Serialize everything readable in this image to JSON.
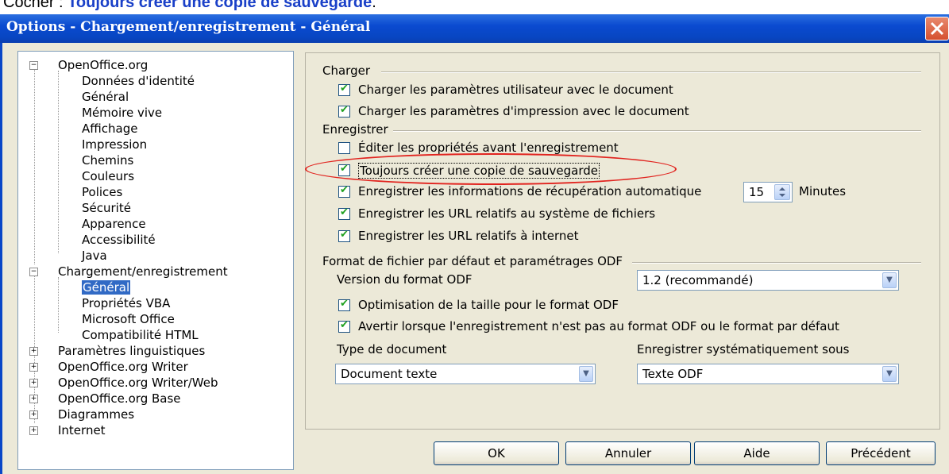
{
  "caption": {
    "prefix": "Cocher : ",
    "bold": "Toujours créer une copie de sauvegarde",
    "suffix": "."
  },
  "window": {
    "title": "Options - Chargement/enregistrement - Général"
  },
  "tree": {
    "openoffice": "OpenOffice.org",
    "oo_children": [
      "Données d'identité",
      "Général",
      "Mémoire vive",
      "Affichage",
      "Impression",
      "Chemins",
      "Couleurs",
      "Polices",
      "Sécurité",
      "Apparence",
      "Accessibilité",
      "Java"
    ],
    "load_save": "Chargement/enregistrement",
    "ls_children": [
      "Général",
      "Propriétés VBA",
      "Microsoft Office",
      "Compatibilité HTML"
    ],
    "collapsed": [
      "Paramètres linguistiques",
      "OpenOffice.org Writer",
      "OpenOffice.org Writer/Web",
      "OpenOffice.org Base",
      "Diagrammes",
      "Internet"
    ]
  },
  "load": {
    "heading": "Charger",
    "items": [
      {
        "label": "Charger les paramètres utilisateur avec le document",
        "checked": true
      },
      {
        "label": "Charger les paramètres d'impression avec le document",
        "checked": true
      }
    ]
  },
  "save": {
    "heading": "Enregistrer",
    "items": [
      {
        "label": "Éditer les propriétés avant l'enregistrement",
        "checked": false
      },
      {
        "label": "Toujours créer une copie de sauvegarde",
        "checked": true
      },
      {
        "label": "Enregistrer les informations de récupération automatique",
        "checked": true
      },
      {
        "label": "Enregistrer les URL relatifs au système de fichiers",
        "checked": true
      },
      {
        "label": "Enregistrer les URL relatifs à internet",
        "checked": true
      }
    ],
    "autosave_minutes": "15",
    "minutes_label": "Minutes"
  },
  "format": {
    "heading": "Format de fichier par défaut et paramétrages ODF",
    "version_label": "Version du format ODF",
    "version_value": "1.2 (recommandé)",
    "items": [
      {
        "label": "Optimisation de la taille pour le format ODF",
        "checked": true
      },
      {
        "label": "Avertir lorsque l'enregistrement n'est pas au format ODF ou le format par défaut",
        "checked": true
      }
    ],
    "doctype_label": "Type de document",
    "doctype_value": "Document texte",
    "saveas_label": "Enregistrer systématiquement sous",
    "saveas_value": "Texte ODF"
  },
  "buttons": {
    "ok": "OK",
    "cancel": "Annuler",
    "help": "Aide",
    "back": "Précédent"
  },
  "colors": {
    "highlight_oval": "#e1241f",
    "titlebar": "#0a4ad0",
    "caption_bold": "#1a40c8"
  }
}
